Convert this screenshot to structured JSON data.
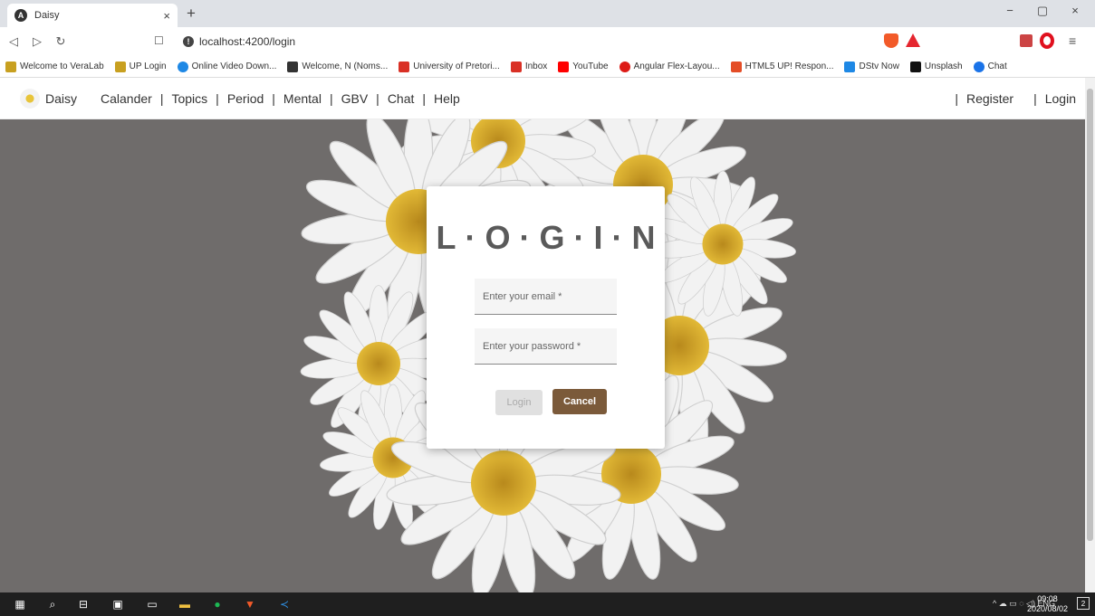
{
  "browser": {
    "tab_title": "Daisy",
    "tab_close": "×",
    "new_tab": "+",
    "url": "localhost:4200/login",
    "window_controls": [
      "−",
      "▢",
      "×"
    ],
    "bookmarks": [
      {
        "label": "Welcome to VeraLab",
        "icon_color": "#c8a020"
      },
      {
        "label": "UP Login",
        "icon_color": "#c8a020"
      },
      {
        "label": "Online Video Down...",
        "icon_color": "#1e88e5"
      },
      {
        "label": "Welcome, N (Noms...",
        "icon_color": "#333333"
      },
      {
        "label": "University of Pretori...",
        "icon_color": "#d93025"
      },
      {
        "label": "Inbox",
        "icon_color": "#d93025"
      },
      {
        "label": "YouTube",
        "icon_color": "#ff0000"
      },
      {
        "label": "Angular Flex-Layou...",
        "icon_color": "#dd1b16"
      },
      {
        "label": "HTML5 UP! Respon...",
        "icon_color": "#e44d26"
      },
      {
        "label": "DStv Now",
        "icon_color": "#1e88e5"
      },
      {
        "label": "Unsplash",
        "icon_color": "#111111"
      },
      {
        "label": "Chat",
        "icon_color": "#1a73e8"
      }
    ]
  },
  "app": {
    "brand": "Daisy",
    "nav": [
      "Calander",
      "Topics",
      "Period",
      "Mental",
      "GBV",
      "Chat",
      "Help"
    ],
    "separator": "|",
    "register": "Register",
    "login_link": "Login"
  },
  "login_form": {
    "title": "L·O·G·I·N",
    "email_placeholder": "Enter your email *",
    "password_placeholder": "Enter your password *",
    "login_button": "Login",
    "cancel_button": "Cancel"
  },
  "taskbar": {
    "language": "ENG",
    "time": "09:08",
    "date": "2020/08/02",
    "notifications": "2"
  },
  "colors": {
    "accent_brown": "#7b5a3a",
    "background_gray": "#6f6c6b",
    "daisy_yellow": "#d6a92a"
  }
}
